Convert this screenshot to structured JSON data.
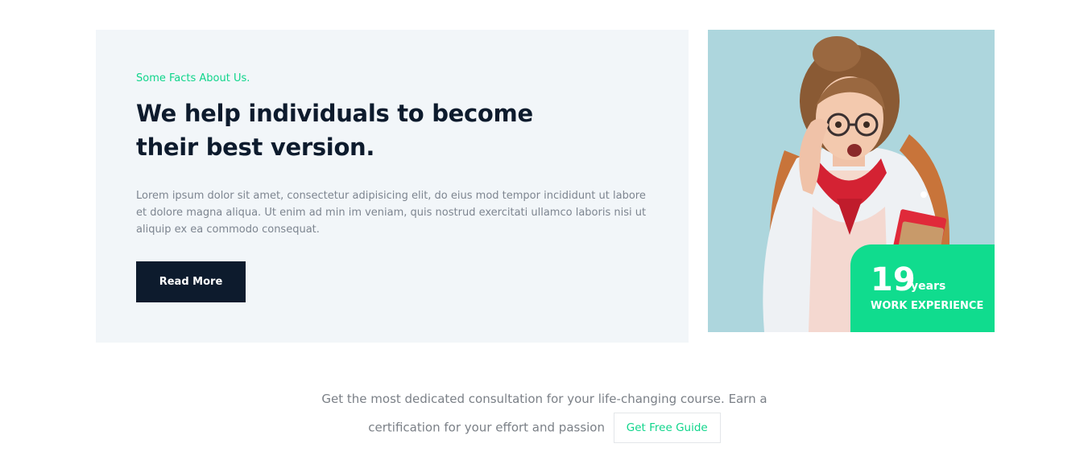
{
  "facts": {
    "eyebrow": "Some Facts About Us.",
    "headline": "We help individuals to become their best version.",
    "body": "Lorem ipsum dolor sit amet, consectetur adipisicing elit, do eius mod tempor incididunt ut labore et dolore magna aliqua. Ut enim ad min im veniam, quis nostrud exercitati ullamco laboris nisi ut aliquip ex ea commodo consequat.",
    "read_more_label": "Read More"
  },
  "experience": {
    "number": "19",
    "unit": "years",
    "label": "WORK EXPERIENCE"
  },
  "cta": {
    "text": "Get the most dedicated consultation for your life-changing course. Earn a certification for your effort and passion",
    "link_label": "Get Free Guide"
  },
  "colors": {
    "accent": "#10dc8e",
    "dark": "#0d1b2d",
    "card_bg": "#f2f6f9",
    "photo_bg": "#add6dd"
  }
}
